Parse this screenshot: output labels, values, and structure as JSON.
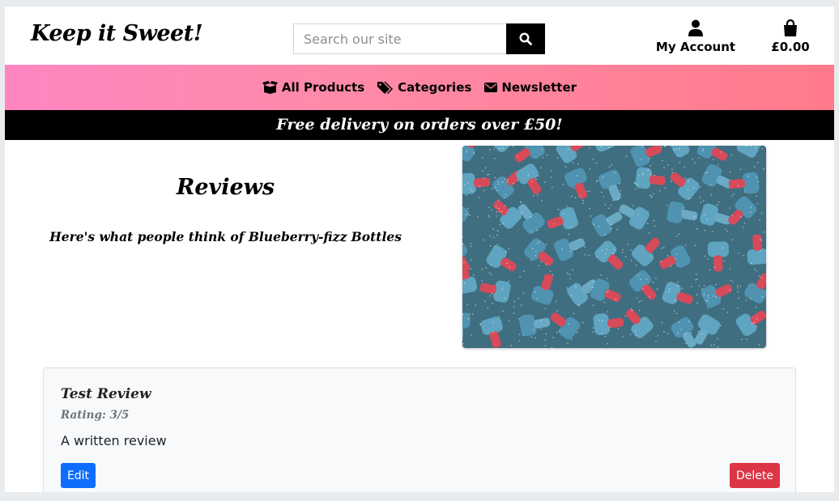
{
  "header": {
    "logo": "Keep it Sweet!",
    "search": {
      "placeholder": "Search our site",
      "value": ""
    },
    "account_label": "My Account",
    "bag_total": "£0.00"
  },
  "nav": {
    "items": [
      {
        "label": "All Products",
        "icon": "box-open-icon"
      },
      {
        "label": "Categories",
        "icon": "tags-icon"
      },
      {
        "label": "Newsletter",
        "icon": "envelope-icon"
      }
    ]
  },
  "banner": {
    "text": "Free delivery on orders over £50!"
  },
  "main": {
    "title": "Reviews",
    "subtitle": "Here's what people think of Blueberry-fizz Bottles",
    "product_image": "blueberry-fizz-bottles-photo"
  },
  "review": {
    "title": "Test Review",
    "rating": "Rating: 3/5",
    "body": "A written review",
    "edit_label": "Edit",
    "delete_label": "Delete"
  },
  "colors": {
    "nav_gradient_start": "#ff85c1",
    "nav_gradient_end": "#ff7a8c",
    "edit_button": "#0d6efd",
    "delete_button": "#dc3545",
    "banner_bg": "#000000"
  }
}
